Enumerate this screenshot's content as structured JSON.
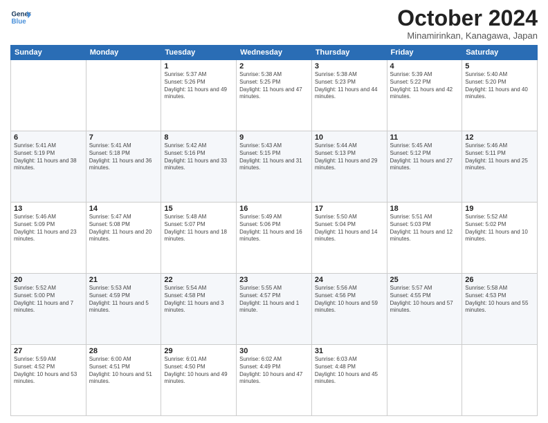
{
  "header": {
    "logo_line1": "General",
    "logo_line2": "Blue",
    "month": "October 2024",
    "location": "Minamirinkan, Kanagawa, Japan"
  },
  "weekdays": [
    "Sunday",
    "Monday",
    "Tuesday",
    "Wednesday",
    "Thursday",
    "Friday",
    "Saturday"
  ],
  "weeks": [
    [
      {
        "day": "",
        "text": ""
      },
      {
        "day": "",
        "text": ""
      },
      {
        "day": "1",
        "text": "Sunrise: 5:37 AM\nSunset: 5:26 PM\nDaylight: 11 hours and 49 minutes."
      },
      {
        "day": "2",
        "text": "Sunrise: 5:38 AM\nSunset: 5:25 PM\nDaylight: 11 hours and 47 minutes."
      },
      {
        "day": "3",
        "text": "Sunrise: 5:38 AM\nSunset: 5:23 PM\nDaylight: 11 hours and 44 minutes."
      },
      {
        "day": "4",
        "text": "Sunrise: 5:39 AM\nSunset: 5:22 PM\nDaylight: 11 hours and 42 minutes."
      },
      {
        "day": "5",
        "text": "Sunrise: 5:40 AM\nSunset: 5:20 PM\nDaylight: 11 hours and 40 minutes."
      }
    ],
    [
      {
        "day": "6",
        "text": "Sunrise: 5:41 AM\nSunset: 5:19 PM\nDaylight: 11 hours and 38 minutes."
      },
      {
        "day": "7",
        "text": "Sunrise: 5:41 AM\nSunset: 5:18 PM\nDaylight: 11 hours and 36 minutes."
      },
      {
        "day": "8",
        "text": "Sunrise: 5:42 AM\nSunset: 5:16 PM\nDaylight: 11 hours and 33 minutes."
      },
      {
        "day": "9",
        "text": "Sunrise: 5:43 AM\nSunset: 5:15 PM\nDaylight: 11 hours and 31 minutes."
      },
      {
        "day": "10",
        "text": "Sunrise: 5:44 AM\nSunset: 5:13 PM\nDaylight: 11 hours and 29 minutes."
      },
      {
        "day": "11",
        "text": "Sunrise: 5:45 AM\nSunset: 5:12 PM\nDaylight: 11 hours and 27 minutes."
      },
      {
        "day": "12",
        "text": "Sunrise: 5:46 AM\nSunset: 5:11 PM\nDaylight: 11 hours and 25 minutes."
      }
    ],
    [
      {
        "day": "13",
        "text": "Sunrise: 5:46 AM\nSunset: 5:09 PM\nDaylight: 11 hours and 23 minutes."
      },
      {
        "day": "14",
        "text": "Sunrise: 5:47 AM\nSunset: 5:08 PM\nDaylight: 11 hours and 20 minutes."
      },
      {
        "day": "15",
        "text": "Sunrise: 5:48 AM\nSunset: 5:07 PM\nDaylight: 11 hours and 18 minutes."
      },
      {
        "day": "16",
        "text": "Sunrise: 5:49 AM\nSunset: 5:06 PM\nDaylight: 11 hours and 16 minutes."
      },
      {
        "day": "17",
        "text": "Sunrise: 5:50 AM\nSunset: 5:04 PM\nDaylight: 11 hours and 14 minutes."
      },
      {
        "day": "18",
        "text": "Sunrise: 5:51 AM\nSunset: 5:03 PM\nDaylight: 11 hours and 12 minutes."
      },
      {
        "day": "19",
        "text": "Sunrise: 5:52 AM\nSunset: 5:02 PM\nDaylight: 11 hours and 10 minutes."
      }
    ],
    [
      {
        "day": "20",
        "text": "Sunrise: 5:52 AM\nSunset: 5:00 PM\nDaylight: 11 hours and 7 minutes."
      },
      {
        "day": "21",
        "text": "Sunrise: 5:53 AM\nSunset: 4:59 PM\nDaylight: 11 hours and 5 minutes."
      },
      {
        "day": "22",
        "text": "Sunrise: 5:54 AM\nSunset: 4:58 PM\nDaylight: 11 hours and 3 minutes."
      },
      {
        "day": "23",
        "text": "Sunrise: 5:55 AM\nSunset: 4:57 PM\nDaylight: 11 hours and 1 minute."
      },
      {
        "day": "24",
        "text": "Sunrise: 5:56 AM\nSunset: 4:56 PM\nDaylight: 10 hours and 59 minutes."
      },
      {
        "day": "25",
        "text": "Sunrise: 5:57 AM\nSunset: 4:55 PM\nDaylight: 10 hours and 57 minutes."
      },
      {
        "day": "26",
        "text": "Sunrise: 5:58 AM\nSunset: 4:53 PM\nDaylight: 10 hours and 55 minutes."
      }
    ],
    [
      {
        "day": "27",
        "text": "Sunrise: 5:59 AM\nSunset: 4:52 PM\nDaylight: 10 hours and 53 minutes."
      },
      {
        "day": "28",
        "text": "Sunrise: 6:00 AM\nSunset: 4:51 PM\nDaylight: 10 hours and 51 minutes."
      },
      {
        "day": "29",
        "text": "Sunrise: 6:01 AM\nSunset: 4:50 PM\nDaylight: 10 hours and 49 minutes."
      },
      {
        "day": "30",
        "text": "Sunrise: 6:02 AM\nSunset: 4:49 PM\nDaylight: 10 hours and 47 minutes."
      },
      {
        "day": "31",
        "text": "Sunrise: 6:03 AM\nSunset: 4:48 PM\nDaylight: 10 hours and 45 minutes."
      },
      {
        "day": "",
        "text": ""
      },
      {
        "day": "",
        "text": ""
      }
    ]
  ]
}
